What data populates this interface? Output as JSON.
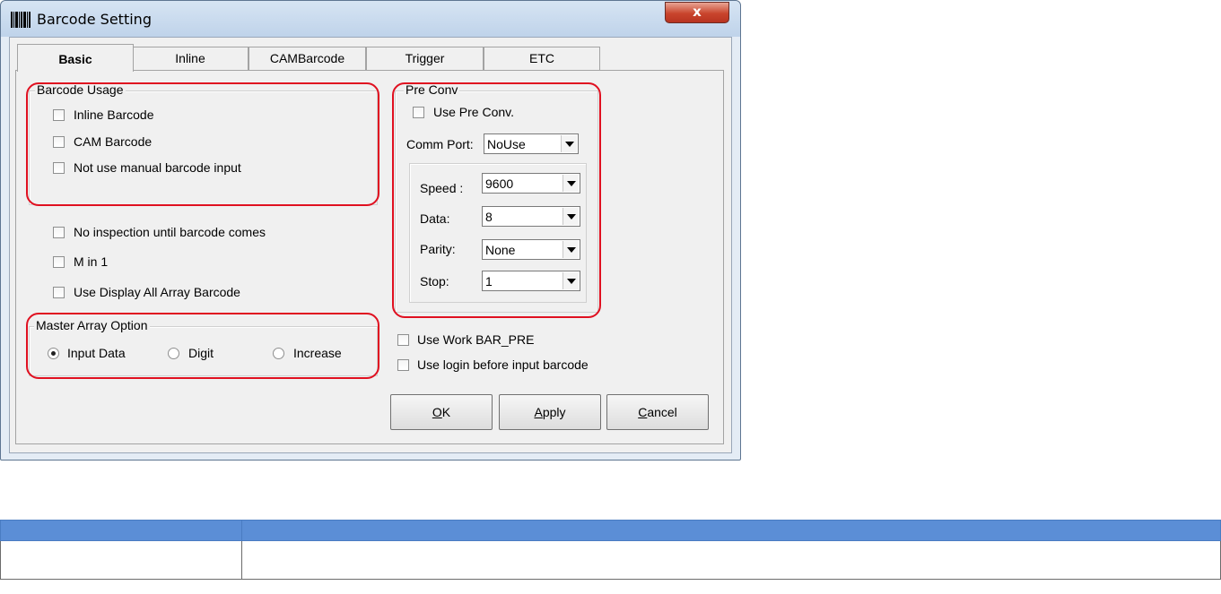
{
  "window": {
    "title": "Barcode Setting",
    "close_label": "x"
  },
  "tabs": [
    {
      "label": "Basic",
      "active": true
    },
    {
      "label": "Inline"
    },
    {
      "label": "CAMBarcode"
    },
    {
      "label": "Trigger"
    },
    {
      "label": "ETC"
    }
  ],
  "barcode_usage": {
    "legend": "Barcode Usage",
    "options": [
      {
        "label": "Inline Barcode",
        "checked": false
      },
      {
        "label": "CAM Barcode",
        "checked": false
      },
      {
        "label": "Not use manual barcode input",
        "checked": false
      }
    ]
  },
  "options": [
    {
      "label": "No inspection until barcode comes",
      "checked": false
    },
    {
      "label": "M in 1",
      "checked": false
    },
    {
      "label": "Use Display All Array Barcode",
      "checked": false
    }
  ],
  "master_array": {
    "legend": "Master Array Option",
    "radios": [
      {
        "label": "Input Data",
        "selected": true
      },
      {
        "label": "Digit",
        "selected": false
      },
      {
        "label": "Increase",
        "selected": false
      }
    ]
  },
  "pre_conv": {
    "legend": "Pre Conv",
    "use_label": "Use Pre Conv.",
    "comm_port_label": "Comm Port:",
    "comm_port_value": "NoUse",
    "speed_label": "Speed :",
    "speed_value": "9600",
    "data_label": "Data:",
    "data_value": "8",
    "parity_label": "Parity:",
    "parity_value": "None",
    "stop_label": "Stop:",
    "stop_value": "1"
  },
  "extra_options": [
    {
      "label": "Use Work BAR_PRE",
      "checked": false
    },
    {
      "label": "Use login before input barcode",
      "checked": false
    }
  ],
  "buttons": {
    "ok_mnemonic": "O",
    "ok_rest": "K",
    "apply_mnemonic": "A",
    "apply_rest": "pply",
    "cancel_mnemonic": "C",
    "cancel_rest": "ancel"
  },
  "colors": {
    "highlight": "#e01020",
    "table_header": "#5b8ed6"
  }
}
